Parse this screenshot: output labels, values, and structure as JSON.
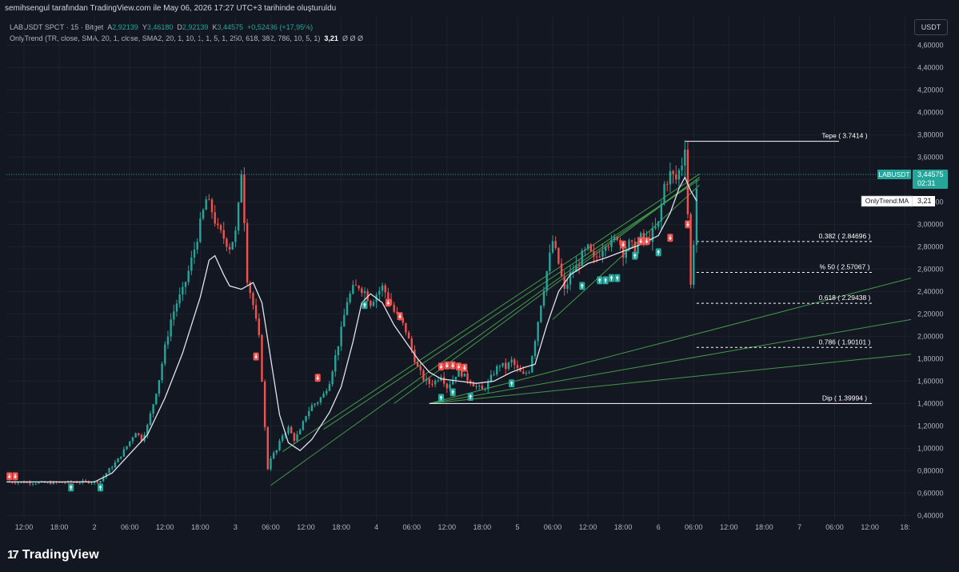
{
  "header": {
    "credit": "semihsengul tarafından TradingView.com ile May 06, 2026 17:27 UTC+3 tarihinde oluşturuldu",
    "symbol": "LABUSDT SPOT · 15 · Bitget",
    "ohlc": {
      "a_label": "A",
      "a": "2,92139",
      "y_label": "Y",
      "y": "3,46180",
      "d_label": "D",
      "d": "2,92139",
      "k_label": "K",
      "k": "3,44575",
      "change": "+0,52436 (+17,95%)"
    },
    "indicator": "OnlyTrend (TR, close, SMA, 20, 1, close, SMA2, 20, 1, 10, 1, 1, 5, 1, 250, 618, 382, 786, 10, 5, 1)",
    "indicator_value": "3,21",
    "indicator_flags": "Ø Ø Ø"
  },
  "currency_button": "USDT",
  "footer": {
    "brand": "TradingView"
  },
  "colors": {
    "bg": "#131722",
    "up": "#26a69a",
    "down": "#ef5350",
    "ma": "#e0e3eb",
    "trend": "#4caf50",
    "grid": "#1e222d",
    "axis_text": "#b2b5be"
  },
  "chart_data": {
    "type": "candlestick",
    "symbol": "LABUSDT",
    "timeframe": "15",
    "y_axis": {
      "ticks": [
        "0,40000",
        "0,60000",
        "0,80000",
        "1,00000",
        "1,20000",
        "1,40000",
        "1,60000",
        "1,80000",
        "2,00000",
        "2,20000",
        "2,40000",
        "2,60000",
        "2,80000",
        "3,00000",
        "3,20000",
        "3,40000",
        "3,60000",
        "3,80000",
        "4,00000",
        "4,20000",
        "4,40000",
        "4,60000"
      ],
      "range": [
        0.36,
        4.66
      ]
    },
    "x_axis": {
      "ticks": [
        "12:00",
        "18:00",
        "2",
        "06:00",
        "12:00",
        "18:00",
        "3",
        "06:00",
        "12:00",
        "18:00",
        "4",
        "06:00",
        "12:00",
        "18:00",
        "5",
        "06:00",
        "12:00",
        "18:00",
        "6",
        "06:00",
        "12:00",
        "18:00",
        "7",
        "06:00",
        "12:00",
        "18:"
      ],
      "range_hours": [
        -15,
        139
      ]
    },
    "price_series": [
      [
        -15,
        0.7
      ],
      [
        -8,
        0.69
      ],
      [
        -2,
        0.7
      ],
      [
        0,
        0.7
      ],
      [
        1,
        0.71
      ],
      [
        2,
        0.78
      ],
      [
        4,
        0.9
      ],
      [
        5.5,
        1.02
      ],
      [
        7,
        1.15
      ],
      [
        8,
        1.08
      ],
      [
        9,
        1.2
      ],
      [
        10,
        1.4
      ],
      [
        11,
        1.62
      ],
      [
        12,
        1.9
      ],
      [
        13,
        2.15
      ],
      [
        14,
        2.3
      ],
      [
        15,
        2.4
      ],
      [
        16,
        2.58
      ],
      [
        17,
        2.78
      ],
      [
        18,
        3.0
      ],
      [
        19,
        3.22
      ],
      [
        20,
        3.12
      ],
      [
        21,
        2.95
      ],
      [
        22,
        2.88
      ],
      [
        23,
        2.8
      ],
      [
        24,
        2.92
      ],
      [
        24.5,
        3.15
      ],
      [
        25,
        3.48
      ],
      [
        25.5,
        3.05
      ],
      [
        26,
        2.52
      ],
      [
        27,
        2.28
      ],
      [
        28,
        1.98
      ],
      [
        28.5,
        1.62
      ],
      [
        29,
        1.18
      ],
      [
        29.5,
        0.82
      ],
      [
        30,
        0.92
      ],
      [
        31,
        0.98
      ],
      [
        32,
        1.12
      ],
      [
        33,
        1.18
      ],
      [
        34,
        1.08
      ],
      [
        35,
        1.15
      ],
      [
        36,
        1.3
      ],
      [
        37,
        1.38
      ],
      [
        38,
        1.42
      ],
      [
        39,
        1.48
      ],
      [
        40,
        1.6
      ],
      [
        41,
        1.82
      ],
      [
        42,
        2.05
      ],
      [
        43,
        2.32
      ],
      [
        44,
        2.42
      ],
      [
        45,
        2.45
      ],
      [
        46,
        2.4
      ],
      [
        47,
        2.3
      ],
      [
        48,
        2.38
      ],
      [
        49,
        2.44
      ],
      [
        50,
        2.35
      ],
      [
        51,
        2.22
      ],
      [
        52,
        2.15
      ],
      [
        53,
        2.05
      ],
      [
        54,
        1.88
      ],
      [
        55,
        1.72
      ],
      [
        56,
        1.62
      ],
      [
        57,
        1.58
      ],
      [
        58,
        1.6
      ],
      [
        59,
        1.66
      ],
      [
        60,
        1.55
      ],
      [
        61,
        1.62
      ],
      [
        62,
        1.7
      ],
      [
        63,
        1.64
      ],
      [
        64,
        1.6
      ],
      [
        65,
        1.55
      ],
      [
        66,
        1.52
      ],
      [
        67,
        1.58
      ],
      [
        68,
        1.68
      ],
      [
        69,
        1.75
      ],
      [
        70,
        1.72
      ],
      [
        71,
        1.78
      ],
      [
        72,
        1.7
      ],
      [
        73,
        1.65
      ],
      [
        74,
        1.7
      ],
      [
        75,
        1.98
      ],
      [
        76,
        2.3
      ],
      [
        77,
        2.58
      ],
      [
        78,
        2.85
      ],
      [
        79,
        2.65
      ],
      [
        80,
        2.4
      ],
      [
        81,
        2.55
      ],
      [
        82,
        2.62
      ],
      [
        83,
        2.72
      ],
      [
        84,
        2.78
      ],
      [
        85,
        2.68
      ],
      [
        86,
        2.75
      ],
      [
        87,
        2.85
      ],
      [
        88,
        2.82
      ],
      [
        89,
        2.9
      ],
      [
        90,
        2.75
      ],
      [
        91,
        2.82
      ],
      [
        92,
        2.78
      ],
      [
        93,
        2.88
      ],
      [
        94,
        2.85
      ],
      [
        95,
        2.92
      ],
      [
        96,
        3.0
      ],
      [
        97,
        3.35
      ],
      [
        98,
        3.45
      ],
      [
        99,
        3.4
      ],
      [
        100,
        3.55
      ],
      [
        100.5,
        3.72
      ],
      [
        101,
        3.1
      ],
      [
        101.5,
        2.45
      ],
      [
        102,
        2.85
      ],
      [
        102.5,
        3.32
      ],
      [
        102.8,
        3.44575
      ]
    ],
    "moving_average": [
      [
        -15,
        0.7
      ],
      [
        0,
        0.7
      ],
      [
        3,
        0.78
      ],
      [
        6,
        0.95
      ],
      [
        9,
        1.12
      ],
      [
        12,
        1.45
      ],
      [
        15,
        1.85
      ],
      [
        18,
        2.35
      ],
      [
        19.5,
        2.68
      ],
      [
        20.5,
        2.72
      ],
      [
        22,
        2.55
      ],
      [
        23,
        2.45
      ],
      [
        25,
        2.42
      ],
      [
        27,
        2.48
      ],
      [
        28.5,
        2.3
      ],
      [
        30,
        1.8
      ],
      [
        31.5,
        1.3
      ],
      [
        33,
        1.05
      ],
      [
        35,
        0.98
      ],
      [
        37,
        1.08
      ],
      [
        40,
        1.32
      ],
      [
        42,
        1.55
      ],
      [
        44,
        1.95
      ],
      [
        45.5,
        2.3
      ],
      [
        47,
        2.38
      ],
      [
        49,
        2.3
      ],
      [
        51,
        2.1
      ],
      [
        53,
        1.95
      ],
      [
        55,
        1.8
      ],
      [
        57,
        1.68
      ],
      [
        59,
        1.62
      ],
      [
        62,
        1.6
      ],
      [
        65,
        1.58
      ],
      [
        68,
        1.6
      ],
      [
        71,
        1.68
      ],
      [
        73,
        1.72
      ],
      [
        75,
        1.75
      ],
      [
        77,
        2.1
      ],
      [
        79,
        2.4
      ],
      [
        81,
        2.55
      ],
      [
        84,
        2.65
      ],
      [
        87,
        2.7
      ],
      [
        90,
        2.76
      ],
      [
        93,
        2.82
      ],
      [
        96,
        2.9
      ],
      [
        98,
        3.1
      ],
      [
        99.5,
        3.32
      ],
      [
        100.5,
        3.42
      ],
      [
        101.5,
        3.3
      ],
      [
        102.5,
        3.21
      ]
    ],
    "ma_label": "OnlyTrend:MA",
    "ma_value": "3,21",
    "last_price": {
      "symbol": "LABUSDT",
      "value": "3,44575",
      "countdown": "02:31"
    },
    "fibonacci": [
      {
        "label": "Tepe ( 3.7414 )",
        "value": 3.7414
      },
      {
        "label": "0.382 ( 2.84696 )",
        "value": 2.84696
      },
      {
        "label": "% 50 ( 2.57067 )",
        "value": 2.57067
      },
      {
        "label": "0.618 ( 2.29438 )",
        "value": 2.29438
      },
      {
        "label": "0.786 ( 1.90101 )",
        "value": 1.90101
      },
      {
        "label": "Dip ( 1.39994 )",
        "value": 1.39994
      }
    ],
    "trend_lines": [
      [
        [
          30,
          0.67
        ],
        [
          103,
          3.42
        ]
      ],
      [
        [
          32,
          0.97
        ],
        [
          103,
          3.45
        ]
      ],
      [
        [
          39,
          1.17
        ],
        [
          103,
          3.4
        ]
      ],
      [
        [
          51,
          1.4
        ],
        [
          103,
          3.42
        ]
      ],
      [
        [
          57,
          1.4
        ],
        [
          139,
          2.52
        ]
      ],
      [
        [
          57,
          1.4
        ],
        [
          139,
          2.15
        ]
      ],
      [
        [
          57,
          1.4
        ],
        [
          139,
          1.84
        ]
      ],
      [
        [
          78,
          2.15
        ],
        [
          103,
          3.35
        ]
      ]
    ],
    "signals": {
      "buy": [
        [
          -4,
          0.65
        ],
        [
          1,
          0.65
        ],
        [
          46,
          2.28
        ],
        [
          59,
          1.45
        ],
        [
          61,
          1.5
        ],
        [
          64,
          1.46
        ],
        [
          71,
          1.58
        ],
        [
          83,
          2.45
        ],
        [
          86,
          2.5
        ],
        [
          87,
          2.5
        ],
        [
          88,
          2.52
        ],
        [
          89,
          2.52
        ],
        [
          92,
          2.72
        ],
        [
          96,
          2.75
        ]
      ],
      "sell": [
        [
          -14.5,
          0.75
        ],
        [
          -13.5,
          0.75
        ],
        [
          27.5,
          1.82
        ],
        [
          38,
          1.63
        ],
        [
          50,
          2.3
        ],
        [
          52,
          2.18
        ],
        [
          59,
          1.73
        ],
        [
          60,
          1.74
        ],
        [
          61,
          1.74
        ],
        [
          62,
          1.73
        ],
        [
          63,
          1.72
        ],
        [
          90,
          2.82
        ],
        [
          93,
          2.85
        ],
        [
          94,
          2.85
        ],
        [
          98,
          2.88
        ],
        [
          101,
          3.0
        ]
      ]
    }
  }
}
